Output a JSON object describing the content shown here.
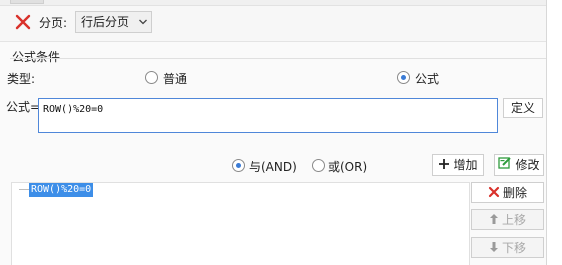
{
  "page_break": {
    "label": "分页:",
    "selected": "行后分页"
  },
  "formula_condition": {
    "title": "公式条件",
    "type_label": "类型:",
    "options": [
      {
        "label": "普通",
        "checked": false
      },
      {
        "label": "公式",
        "checked": true
      }
    ],
    "formula_label": "公式=",
    "formula_value": "ROW()%20=0",
    "define_button": "定义"
  },
  "logic": {
    "options": [
      {
        "label": "与(AND)",
        "checked": true
      },
      {
        "label": "或(OR)",
        "checked": false
      }
    ],
    "add_button": "增加",
    "modify_button": "修改"
  },
  "conditions_list": {
    "items": [
      "ROW()%20=0"
    ],
    "delete_button": "删除",
    "move_up_button": "上移",
    "move_down_button": "下移"
  },
  "colors": {
    "accent": "#3a7bd5",
    "selection": "#3d8ee8",
    "delete_red": "#d9312b",
    "modify_green": "#2e9c3c"
  }
}
